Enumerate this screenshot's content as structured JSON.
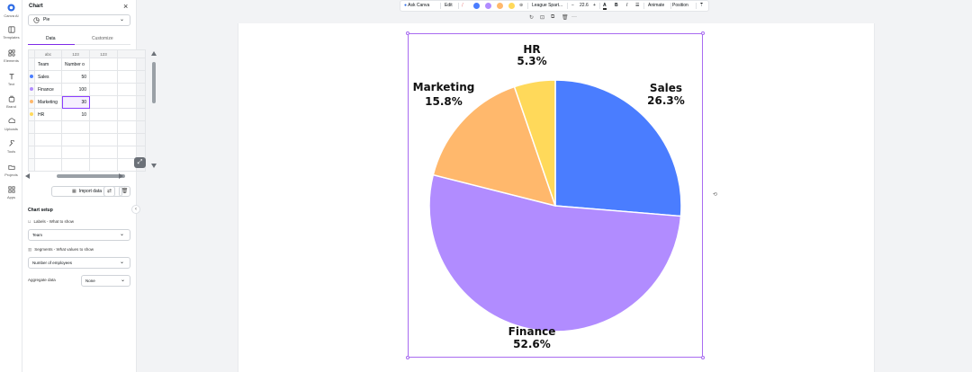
{
  "rail": {
    "items": [
      {
        "label": "Canva AI",
        "icon": "canva-ai-icon"
      },
      {
        "label": "Templates",
        "icon": "templates-icon"
      },
      {
        "label": "Elements",
        "icon": "elements-icon"
      },
      {
        "label": "Text",
        "icon": "text-icon"
      },
      {
        "label": "Brand",
        "icon": "brand-icon"
      },
      {
        "label": "Uploads",
        "icon": "uploads-icon"
      },
      {
        "label": "Tools",
        "icon": "tools-icon"
      },
      {
        "label": "Projects",
        "icon": "projects-icon"
      },
      {
        "label": "Apps",
        "icon": "apps-icon"
      }
    ]
  },
  "panel": {
    "title": "Chart",
    "chart_type": "Pie",
    "tabs": [
      {
        "label": "Data",
        "active": true
      },
      {
        "label": "Customize",
        "active": false
      }
    ],
    "grid": {
      "col_types": [
        "abc",
        "123",
        "123"
      ],
      "headers": [
        "Team",
        "Number o"
      ],
      "rows": [
        {
          "label": "Sales",
          "value": "50",
          "color": "#4a7dff"
        },
        {
          "label": "Finance",
          "value": "100",
          "color": "#b18cff"
        },
        {
          "label": "Marketing",
          "value": "30",
          "color": "#ffb86c"
        },
        {
          "label": "HR",
          "value": "10",
          "color": "#ffd95a"
        }
      ]
    },
    "import_label": "Import data",
    "setup_title": "Chart setup",
    "labels_title": "Labels - What to show",
    "labels_value": "Team",
    "segments_title": "Segments - What values to show",
    "segments_value": "Number of employees",
    "aggregate_label": "Aggregate data",
    "aggregate_value": "None"
  },
  "toolbar": {
    "ask": "Ask Canva",
    "edit": "Edit",
    "font": "League Spart...",
    "font_size": "22.6",
    "bold": "B",
    "italic": "I",
    "animate": "Animate",
    "position": "Position",
    "swatches": [
      "#4a7dff",
      "#b18cff",
      "#ffb86c",
      "#ffd95a"
    ]
  },
  "chart_data": {
    "type": "pie",
    "slices": [
      {
        "label": "Sales",
        "percent_label": "26.3%",
        "value": 50,
        "color": "#4a7dff"
      },
      {
        "label": "Finance",
        "percent_label": "52.6%",
        "value": 100,
        "color": "#b18cff"
      },
      {
        "label": "Marketing",
        "percent_label": "15.8%",
        "value": 30,
        "color": "#ffb86c"
      },
      {
        "label": "HR",
        "percent_label": "5.3%",
        "value": 10,
        "color": "#ffd95a"
      }
    ]
  }
}
